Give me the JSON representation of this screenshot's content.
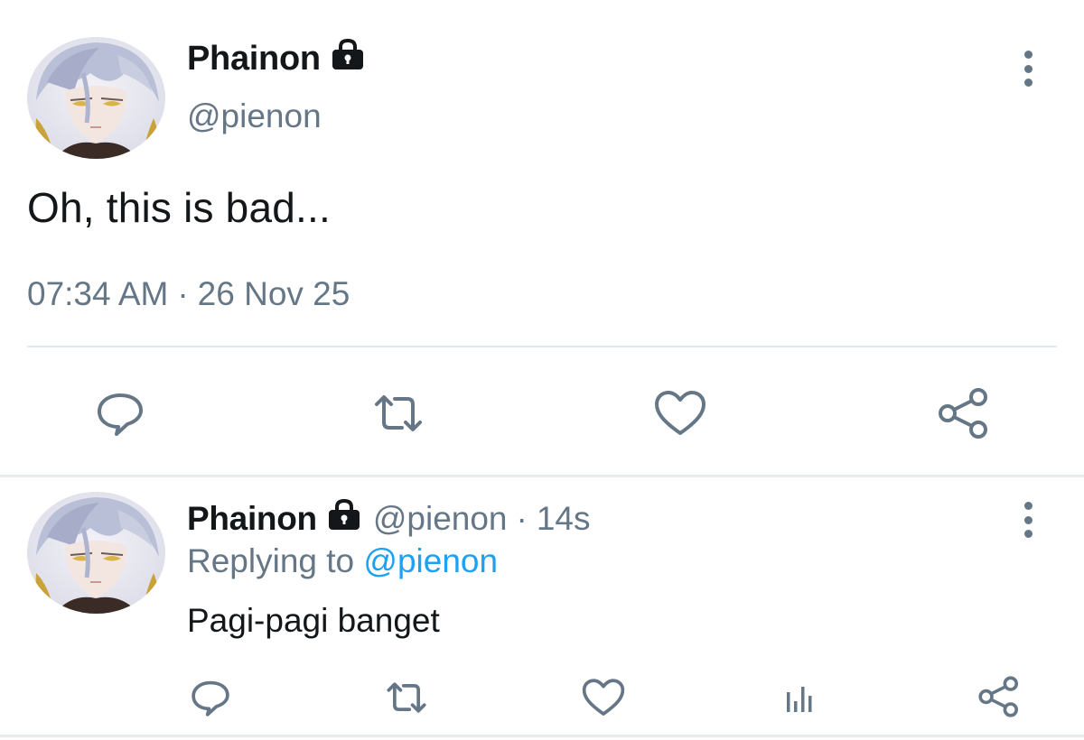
{
  "main_tweet": {
    "display_name": "Phainon",
    "handle": "@pienon",
    "text": "Oh, this is bad...",
    "time": "07:34 AM",
    "separator": "·",
    "date": "26 Nov 25",
    "avatar_icon": "avatar-portrait-icon",
    "lock_icon": "lock-icon"
  },
  "reply": {
    "display_name": "Phainon",
    "handle": "@pienon",
    "separator": "·",
    "age": "14s",
    "replying_prefix": "Replying to",
    "replying_mention": "@pienon",
    "text": "Pagi-pagi banget"
  },
  "actions": {
    "main": [
      "reply-icon",
      "retweet-icon",
      "like-icon",
      "share-icon"
    ],
    "reply": [
      "reply-icon",
      "retweet-icon",
      "like-icon",
      "analytics-icon",
      "share-icon"
    ]
  },
  "colors": {
    "text": "#14171a",
    "secondary": "#657786",
    "link": "#1da1f2",
    "divider": "#e1e8ed"
  }
}
